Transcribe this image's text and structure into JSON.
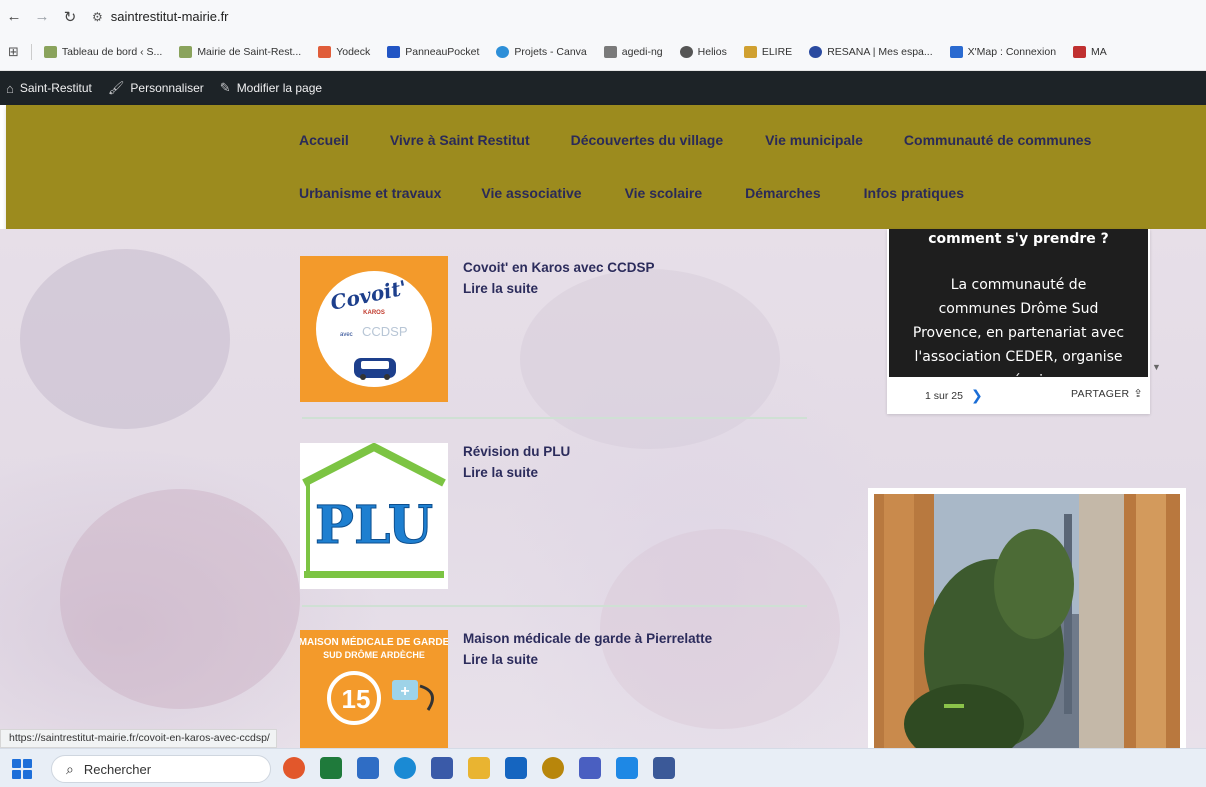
{
  "browser": {
    "url": "saintrestitut-mairie.fr",
    "bookmarks": [
      {
        "label": "Tableau de bord ‹ S...",
        "color": "#8aa35c"
      },
      {
        "label": "Mairie de Saint-Rest...",
        "color": "#8aa35c"
      },
      {
        "label": "Yodeck",
        "color": "#e05d3a"
      },
      {
        "label": "PanneauPocket",
        "color": "#2255c4"
      },
      {
        "label": "Projets - Canva",
        "color": "#2d8fd8"
      },
      {
        "label": "agedi-ng",
        "color": "#7a7a7a"
      },
      {
        "label": "Helios",
        "color": "#555555"
      },
      {
        "label": "ELIRE",
        "color": "#d0a030"
      },
      {
        "label": "RESANA | Mes espa...",
        "color": "#2a4aa0"
      },
      {
        "label": "X'Map : Connexion",
        "color": "#2a6ad0"
      },
      {
        "label": "MA",
        "color": "#c03030"
      }
    ]
  },
  "admin_bar": {
    "site": "Saint-Restitut",
    "customize": "Personnaliser",
    "edit": "Modifier la page"
  },
  "nav": {
    "row1": [
      "Accueil",
      "Vivre à Saint Restitut",
      "Découvertes du village",
      "Vie municipale",
      "Communauté de communes"
    ],
    "row2": [
      "Urbanisme et travaux",
      "Vie associative",
      "Vie scolaire",
      "Démarches",
      "Infos pratiques"
    ]
  },
  "articles": [
    {
      "title": "Covoit' en Karos avec CCDSP",
      "more": "Lire la suite"
    },
    {
      "title": "Révision du PLU",
      "more": "Lire la suite"
    },
    {
      "title": "Maison médicale de garde à Pierrelatte",
      "more": "Lire la suite"
    }
  ],
  "thumbs": {
    "covoit_word": "Covoit'",
    "karos": "KAROS",
    "ccdsp": "CCDSP",
    "avec": "avec",
    "plu": "PLU",
    "maison_line1": "MAISON MÉDICALE DE GARDE",
    "maison_line2": "SUD DRÔME ARDÈCHE",
    "number": "15"
  },
  "slider": {
    "heading": "comment s'y prendre ?",
    "body": "La communauté de communes Drôme Sud Provence, en partenariat avec l'association CEDER, organise une réunion",
    "pager": "1 sur 25",
    "share": "PARTAGER"
  },
  "status_url": "https://saintrestitut-mairie.fr/covoit-en-karos-avec-ccdsp/",
  "taskbar": {
    "search": "Rechercher",
    "apps": [
      "#e2572b",
      "#1f7a3b",
      "#2f6dc5",
      "#1a8ad4",
      "#3a5aa8",
      "#e9b431",
      "#1565c0",
      "#b8860b",
      "#4a5fc1",
      "#1e88e5",
      "#3b5998"
    ]
  }
}
